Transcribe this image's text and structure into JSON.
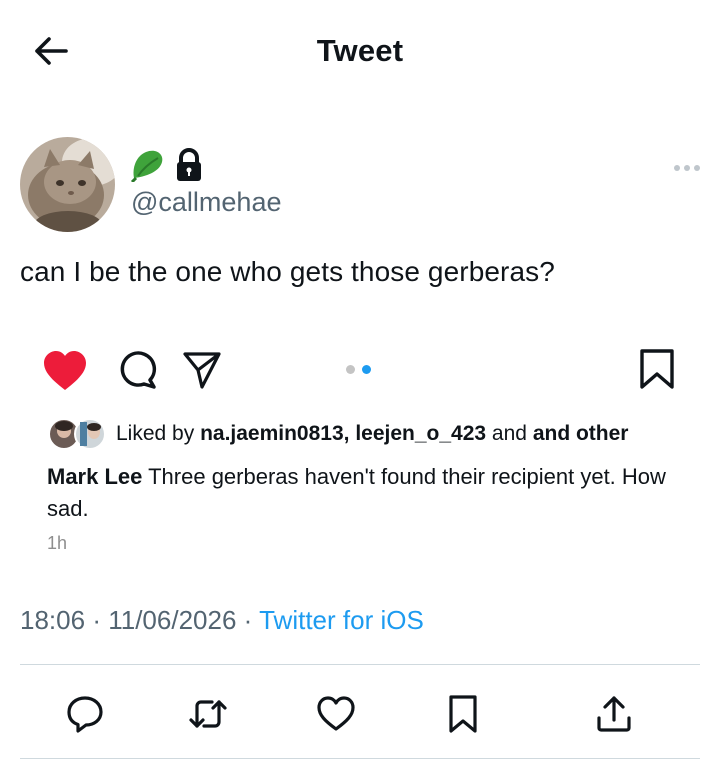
{
  "header": {
    "title": "Tweet"
  },
  "author": {
    "handle": "@callmehae"
  },
  "tweet": {
    "text": "can I be the one who gets those gerberas?",
    "time": "18:06",
    "date": "11/06/2026",
    "source": "Twitter for iOS",
    "separator": "·"
  },
  "embedded_post": {
    "liked_prefix": "Liked by ",
    "liked_users": "na.jaemin0813, leejen_o_423",
    "liked_connector": " and ",
    "liked_suffix": "and other",
    "caption_author": "Mark Lee",
    "caption_text": " Three gerberas haven't found their recipient yet. How sad.",
    "time_ago": "1h",
    "carousel": {
      "total": 2,
      "active": 2
    }
  },
  "colors": {
    "heart": "#ed1c3a",
    "link": "#1d9bf0",
    "muted": "#536471",
    "carousel_active": "#1d9bf0",
    "carousel_inactive": "#c4c4c4"
  }
}
